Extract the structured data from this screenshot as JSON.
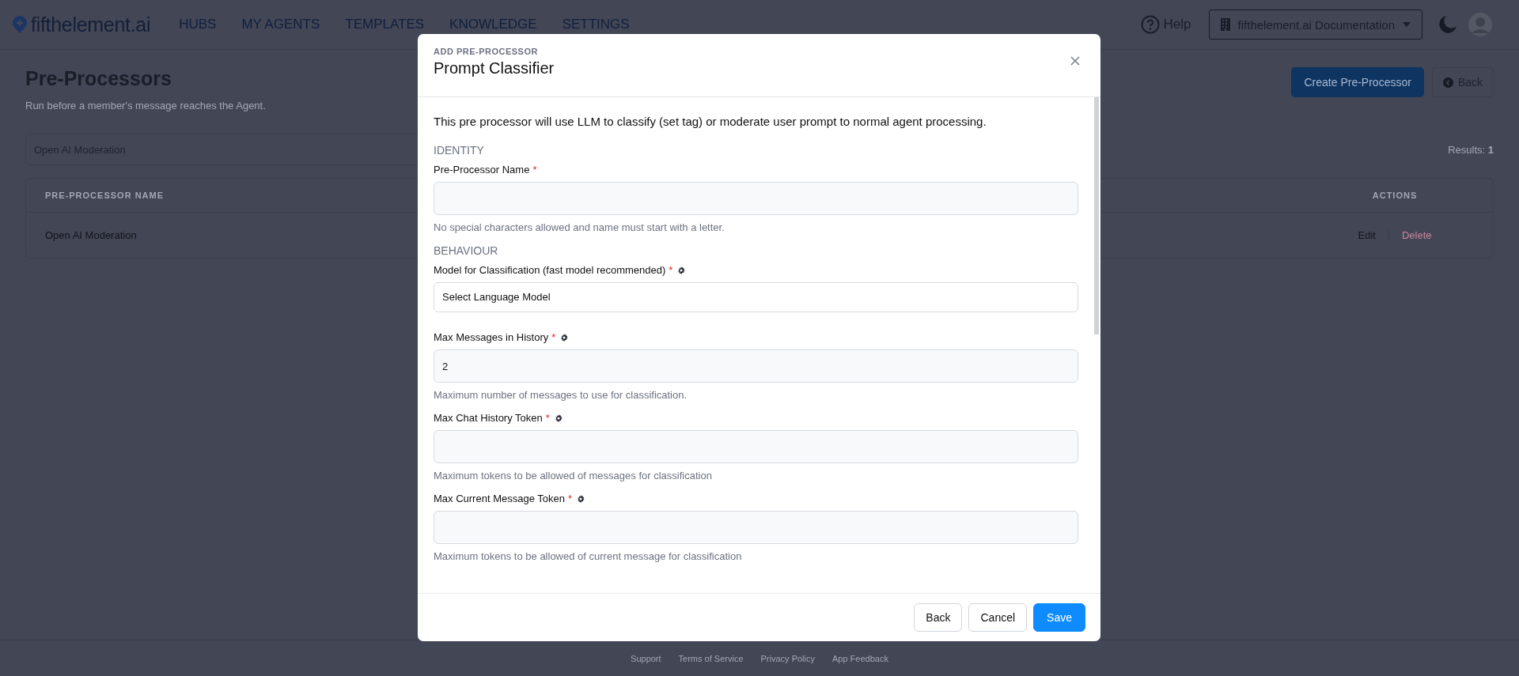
{
  "nav": {
    "logo": "fifthelement.ai",
    "items": [
      "HUBS",
      "MY AGENTS",
      "TEMPLATES",
      "KNOWLEDGE",
      "SETTINGS"
    ],
    "help": "Help",
    "workspace": "fifthelement.ai Documentation"
  },
  "page": {
    "title": "Pre-Processors",
    "subtitle": "Run before a member's message reaches the Agent.",
    "create_button": "Create Pre-Processor",
    "back_button": "Back",
    "search_value": "Open AI Moderation",
    "results": "Results: **1**"
  },
  "table": {
    "columns": [
      {
        "label": "PRE-PROCESSOR NAME",
        "kind": "name"
      },
      {
        "label": "ACTIONS",
        "kind": "actions"
      }
    ],
    "rows": [
      {
        "name": "Open AI Moderation",
        "actions": [
          {
            "label": "Edit",
            "kind": "edit"
          },
          {
            "label": "Delete",
            "kind": "delete"
          }
        ]
      }
    ]
  },
  "modal": {
    "eyebrow": "ADD PRE-PROCESSOR",
    "title": "Prompt Classifier",
    "intro": "This pre processor will use LLM to classify (set tag) or moderate user prompt to normal agent processing.",
    "sections": [
      {
        "heading": "IDENTITY",
        "fields": [
          {
            "kind": "input",
            "label": "Pre-Processor Name",
            "required_mark": "*",
            "hint": "No special characters allowed and name must start with a letter."
          }
        ]
      },
      {
        "heading": "BEHAVIOUR",
        "fields": [
          {
            "kind": "select",
            "label": "Model for Classification (fast model recommended)",
            "required_mark": "*",
            "settings_icon": true,
            "value": "Select Language Model"
          },
          {
            "kind": "input",
            "label": "Max Messages in History",
            "required_mark": "*",
            "settings_icon": true,
            "value": "2",
            "hint": "Maximum number of messages to use for classification."
          },
          {
            "kind": "input",
            "label": "Max Chat History Token",
            "required_mark": "*",
            "settings_icon": true,
            "hint": "Maximum tokens to be allowed of messages for classification"
          },
          {
            "kind": "input",
            "label": "Max Current Message Token",
            "required_mark": "*",
            "settings_icon": true,
            "hint": "Maximum tokens to be allowed of current message for classification"
          }
        ]
      }
    ],
    "buttons": [
      {
        "label": "Back",
        "kind": "secondary"
      },
      {
        "label": "Cancel",
        "kind": "secondary"
      },
      {
        "label": "Save",
        "kind": "primary"
      }
    ]
  },
  "footer": {
    "links": [
      "Support",
      "Terms of Service",
      "Privacy Policy",
      "App Feedback"
    ]
  }
}
